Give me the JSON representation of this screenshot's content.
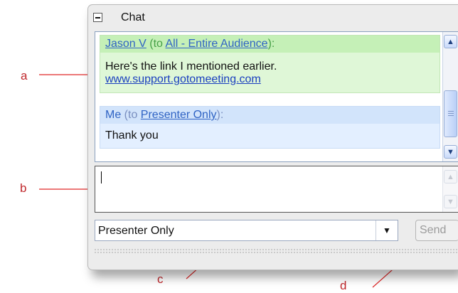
{
  "annotations": {
    "a": "a",
    "b": "b",
    "c": "c",
    "d": "d"
  },
  "panel": {
    "title": "Chat",
    "collapse_symbol": "−",
    "messages": [
      {
        "sender": "Jason V",
        "to_prefix": " (to ",
        "recipient": "All - Entire Audience",
        "to_suffix": "):",
        "text": "Here's the link I mentioned earlier.",
        "link": "www.support.gotomeeting.com"
      },
      {
        "sender": "Me",
        "to_prefix": " (to ",
        "recipient": "Presenter Only",
        "to_suffix": "):",
        "text": "Thank you"
      }
    ],
    "input": {
      "value": ""
    },
    "recipient_select": {
      "selected": "Presenter Only"
    },
    "send_label": "Send"
  },
  "colors": {
    "annotation": "#c0282c",
    "msg_all_bg": "#dff7d7",
    "msg_presenter_bg": "#e3efff",
    "link": "#1a3fbf"
  },
  "icons": {
    "collapse": "minus-box-icon",
    "scroll_up": "arrow-up-icon",
    "scroll_down": "arrow-down-icon",
    "dropdown": "chevron-down-icon"
  }
}
